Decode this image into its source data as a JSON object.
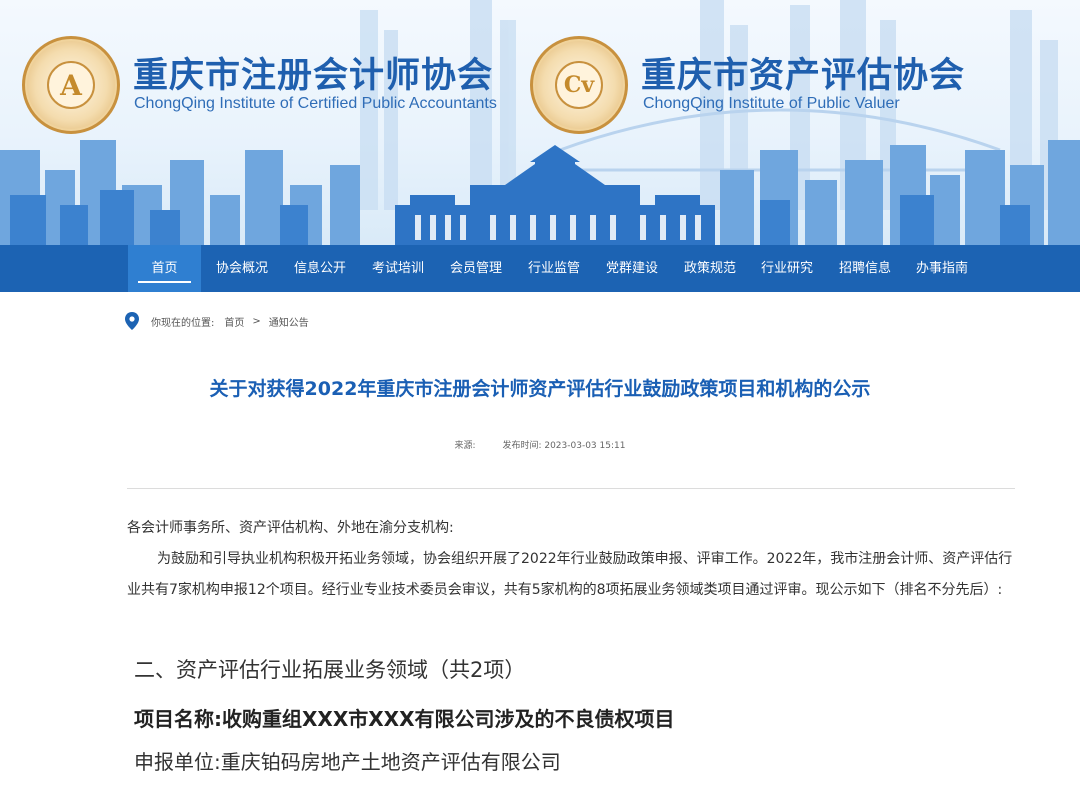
{
  "header": {
    "org1": {
      "name": "重庆市注册会计师协会",
      "en": "ChongQing Institute of Certified Public Accountants",
      "seal_icon": "cpa-seal-icon",
      "seal_letter": "A"
    },
    "org2": {
      "name": "重庆市资产评估协会",
      "en": "ChongQing Institute of Public Valuer",
      "seal_icon": "valuer-seal-icon",
      "seal_letter": "Cv"
    }
  },
  "nav": {
    "items": [
      "首页",
      "协会概况",
      "信息公开",
      "考试培训",
      "会员管理",
      "行业监管",
      "党群建设",
      "政策规范",
      "行业研究",
      "招聘信息",
      "办事指南"
    ],
    "active_index": 0
  },
  "breadcrumb": {
    "label": "你现在的位置:",
    "home": "首页",
    "separator": ">",
    "current": "通知公告"
  },
  "article": {
    "title": "关于对获得2022年重庆市注册会计师资产评估行业鼓励政策项目和机构的公示",
    "source_label": "来源:",
    "time_label": "发布时间:",
    "time": "2023-03-03 15:11",
    "salutation": "各会计师事务所、资产评估机构、外地在渝分支机构:",
    "body": "为鼓励和引导执业机构积极开拓业务领域，协会组织开展了2022年行业鼓励政策申报、评审工作。2022年，我市注册会计师、资产评估行业共有7家机构申报12个项目。经行业专业技术委员会审议，共有5家机构的8项拓展业务领域类项目通过评审。现公示如下（排名不分先后）:",
    "section_heading": "二、资产评估行业拓展业务领域（共2项）",
    "project_name": "项目名称:收购重组XXX市XXX有限公司涉及的不良债权项目",
    "applicant": "申报单位:重庆铂码房地产土地资产评估有限公司"
  },
  "colors": {
    "nav_bg": "#1c63b3",
    "nav_active": "#2f7fd1",
    "title_blue": "#1a5fb4",
    "brand_blue": "#1f5fae",
    "seal_gold": "#c8913e"
  }
}
